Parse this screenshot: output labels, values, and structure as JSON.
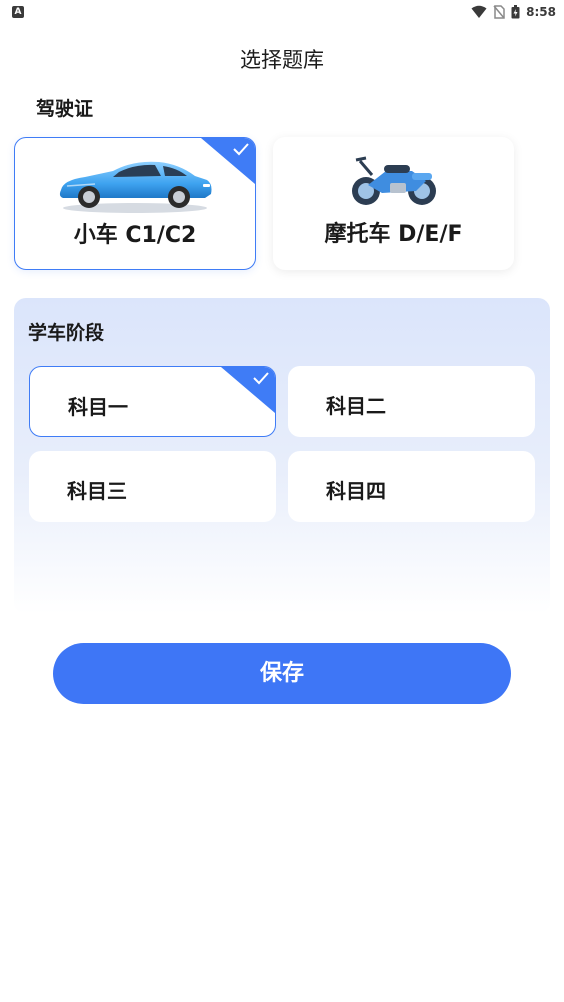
{
  "status_bar": {
    "app_icon_letter": "A",
    "time": "8:58",
    "icons": [
      "wifi-icon",
      "no-sim-icon",
      "battery-icon"
    ]
  },
  "page": {
    "title": "选择题库"
  },
  "license": {
    "label": "驾驶证",
    "options": [
      {
        "label": "小车 C1/C2",
        "icon": "car-icon",
        "selected": true
      },
      {
        "label": "摩托车 D/E/F",
        "icon": "motorcycle-icon",
        "selected": false
      }
    ]
  },
  "stage": {
    "label": "学车阶段",
    "options": [
      {
        "label": "科目一",
        "selected": true
      },
      {
        "label": "科目二",
        "selected": false
      },
      {
        "label": "科目三",
        "selected": false
      },
      {
        "label": "科目四",
        "selected": false
      }
    ]
  },
  "actions": {
    "save_label": "保存"
  },
  "colors": {
    "accent": "#3e76f6",
    "panel_bg": "#dbe5fb"
  }
}
